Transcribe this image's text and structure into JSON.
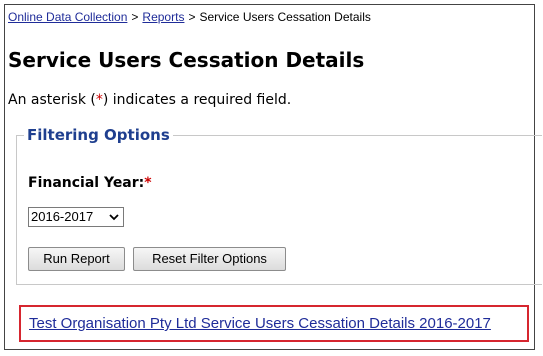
{
  "breadcrumb": {
    "items": [
      {
        "label": "Online Data Collection",
        "link": true
      },
      {
        "label": "Reports",
        "link": true
      },
      {
        "label": "Service Users Cessation Details",
        "link": false
      }
    ],
    "separator": ">"
  },
  "page": {
    "title": "Service Users Cessation Details",
    "required_note_prefix": "An asterisk (",
    "required_note_asterisk": "*",
    "required_note_suffix": ") indicates a required field."
  },
  "filters": {
    "legend": "Filtering Options",
    "financial_year": {
      "label": "Financial Year:",
      "required_mark": "*",
      "selected_value": "2016-2017"
    },
    "run_button_label": "Run Report",
    "reset_button_label": "Reset Filter Options"
  },
  "result": {
    "link_text": "Test Organisation Pty Ltd Service Users Cessation Details 2016-2017"
  },
  "colors": {
    "link": "#1f2c99",
    "required": "#cc0000",
    "legend": "#1f3f8f",
    "highlight_border": "#d6262f"
  }
}
